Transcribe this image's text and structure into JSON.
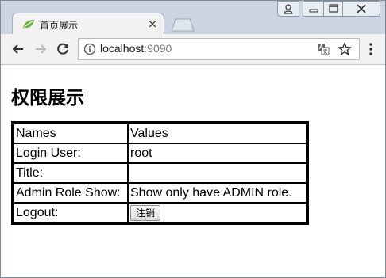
{
  "browser": {
    "tab": {
      "title": "首页展示",
      "close_glyph": "×"
    },
    "address": {
      "host": "localhost",
      "port": ":9090"
    },
    "icons": [
      "back-icon",
      "forward-icon",
      "reload-icon",
      "info-icon",
      "translate-icon",
      "star-icon",
      "menu-icon",
      "leaf-favicon"
    ]
  },
  "page": {
    "heading": "权限展示",
    "table": {
      "header": {
        "name": "Names",
        "value": "Values"
      },
      "rows": [
        {
          "name": "Login User:",
          "value": "root"
        },
        {
          "name": "Title:",
          "value": ""
        },
        {
          "name": "Admin Role Show:",
          "value": "Show only have ADMIN role."
        },
        {
          "name": "Logout:",
          "button_label": "注销"
        }
      ]
    }
  },
  "colors": {
    "tabstrip": "#ccd6e2",
    "toolbar": "#f2f2f2",
    "favicon": "#6db33f"
  }
}
